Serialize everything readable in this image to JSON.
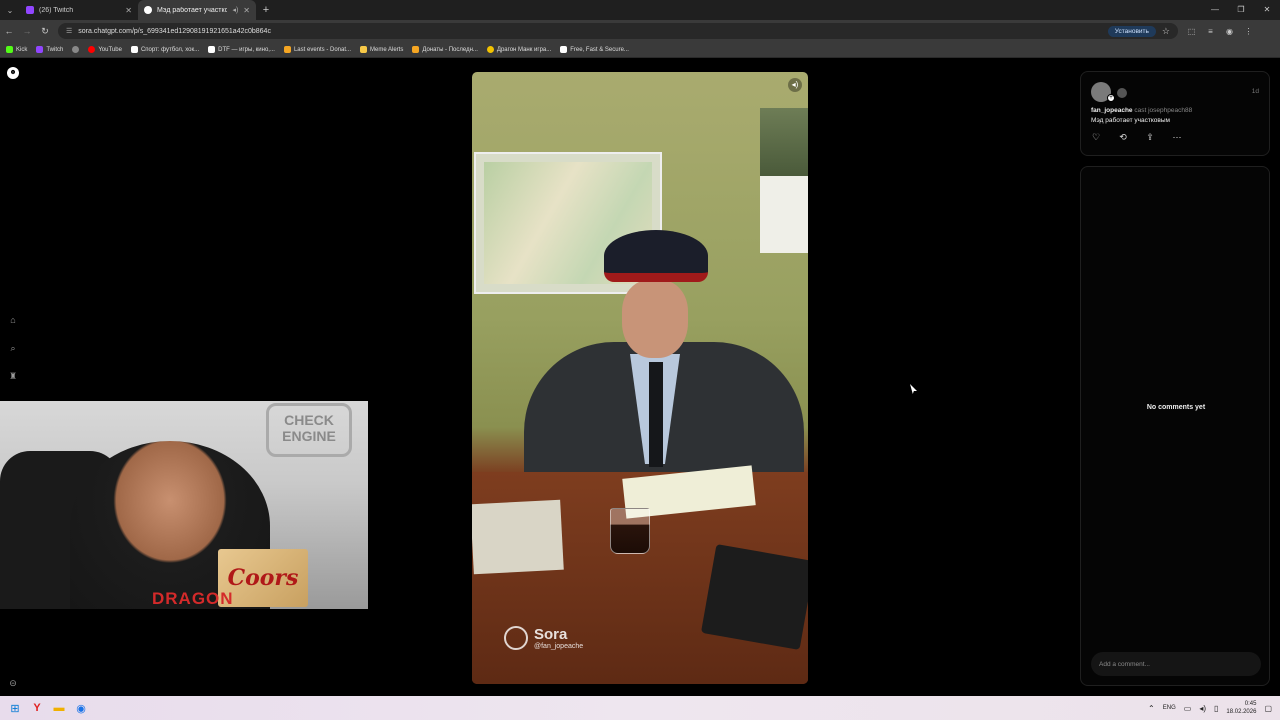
{
  "browser": {
    "tabs": [
      {
        "title": "(26) Twitch",
        "color": "#9146ff",
        "active": false
      },
      {
        "title": "Мэд работает участковым",
        "color": "#ffffff",
        "active": true
      }
    ],
    "url": "sora.chatgpt.com/p/s_699341ed12908191921651a42c0b864c",
    "install_label": "Установить",
    "bookmarks": [
      {
        "label": "Kick",
        "color": "#53fc18"
      },
      {
        "label": "Twitch",
        "color": "#9146ff"
      },
      {
        "label": "",
        "color": "#888888"
      },
      {
        "label": "YouTube",
        "color": "#ff0000"
      },
      {
        "label": "Спорт: футбол, хок...",
        "color": "#ffffff"
      },
      {
        "label": "DTF — игры, кино,...",
        "color": "#ffffff"
      },
      {
        "label": "Last events - Donat...",
        "color": "#f5a623"
      },
      {
        "label": "Meme Alerts",
        "color": "#f7c948"
      },
      {
        "label": "Донаты - Последн...",
        "color": "#f5a623"
      },
      {
        "label": "Драгон Манк игра...",
        "color": "#f2c200"
      },
      {
        "label": "Free, Fast & Secure...",
        "color": "#ffffff"
      }
    ]
  },
  "video": {
    "watermark_name": "Sora",
    "watermark_user": "@fan_jopeache",
    "webcam_sign": "CHECK ENGINE",
    "webcam_shirt": "DRAGON",
    "webcam_box": "Coors"
  },
  "post": {
    "author": "fan_jopeache",
    "cast": "cast josephpeach88",
    "caption": "Мэд работает участковым",
    "time": "1d"
  },
  "comments": {
    "empty_text": "No comments yet",
    "placeholder": "Add a comment..."
  },
  "taskbar": {
    "lang": "ENG",
    "time": "0:45",
    "date": "18.02.2026"
  }
}
